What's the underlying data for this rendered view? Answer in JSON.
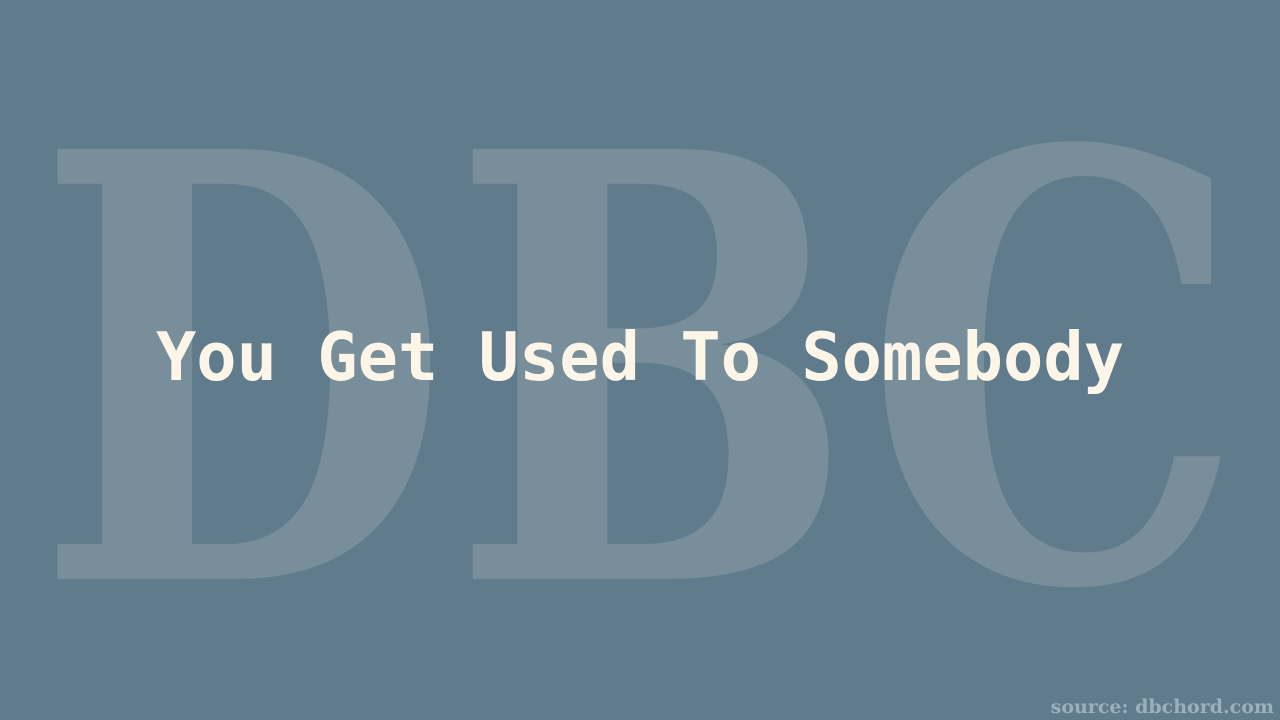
{
  "background_color": "#5f7b8c",
  "watermark": {
    "text": "DBC",
    "color": "#788e9a"
  },
  "title": {
    "text": "You Get Used To Somebody",
    "color": "#fcf5e8"
  },
  "source": {
    "text": "source: dbchord.com",
    "color": "#9cb0bc"
  }
}
